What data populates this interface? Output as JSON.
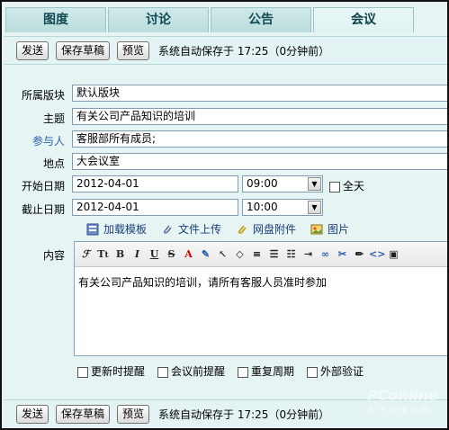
{
  "tabs": [
    {
      "label": "图度",
      "active": false
    },
    {
      "label": "讨论",
      "active": false
    },
    {
      "label": "公告",
      "active": false
    },
    {
      "label": "会议",
      "active": true
    }
  ],
  "actions": {
    "send": "发送",
    "save_draft": "保存草稿",
    "preview": "预览",
    "autosave": "系统自动保存于 17:25（0分钟前）"
  },
  "form": {
    "board_label": "所属版块",
    "board_value": "默认版块",
    "subject_label": "主题",
    "subject_value": "有关公司产品知识的培训",
    "participants_label": "参与人",
    "participants_value": "客服部所有成员;",
    "location_label": "地点",
    "location_value": "大会议室",
    "start_label": "开始日期",
    "start_date": "2012-04-01",
    "start_time": "09:00",
    "allday_label": "全天",
    "end_label": "截止日期",
    "end_date": "2012-04-01",
    "end_time": "10:00",
    "content_label": "内容"
  },
  "attachments": [
    {
      "label": "加载模板",
      "icon": "template-icon"
    },
    {
      "label": "文件上传",
      "icon": "paperclip-icon"
    },
    {
      "label": "网盘附件",
      "icon": "netdisk-clip-icon"
    },
    {
      "label": "图片",
      "icon": "image-icon"
    }
  ],
  "editor": {
    "content": "有关公司产品知识的培训，请所有客服人员准时参加"
  },
  "reminders": {
    "on_update": "更新时提醒",
    "before_meeting": "会议前提醒",
    "repeat": "重复周期",
    "external_verify": "外部验证"
  },
  "watermark": {
    "brand": "PConline",
    "sub": "太平洋电脑网"
  },
  "colors": {
    "background": "#e6f4f4",
    "tab_text": "#124a55",
    "link_label": "#2a5db0"
  }
}
